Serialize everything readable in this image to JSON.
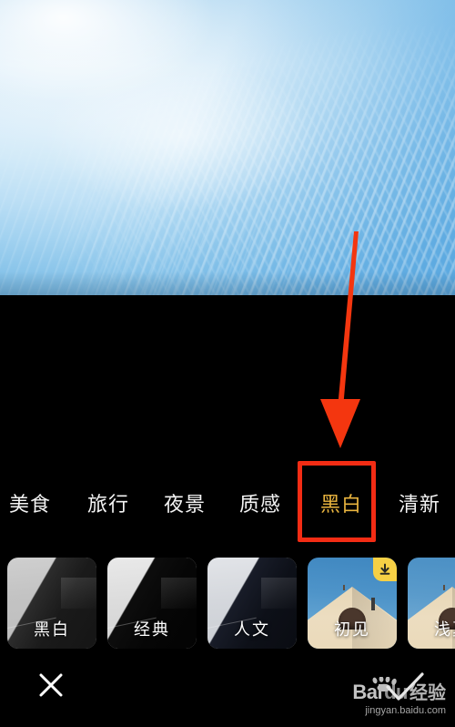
{
  "app": {
    "screen_name": "photo-filter-editor",
    "background_color": "#000000"
  },
  "preview": {
    "name": "sky-photo-preview",
    "description": "蓝天白云 cirrocumulus sky photo",
    "sky_blue": "#6ab2e4",
    "cloud_white": "#f2f9fd"
  },
  "annotation": {
    "arrow_color": "#f4360f",
    "highlight_color": "#f32c14",
    "points_to": "黑白"
  },
  "tabs": {
    "items": [
      {
        "label": "美食",
        "selected": false
      },
      {
        "label": "旅行",
        "selected": false
      },
      {
        "label": "夜景",
        "selected": false
      },
      {
        "label": "质感",
        "selected": false
      },
      {
        "label": "黑白",
        "selected": true
      },
      {
        "label": "清新",
        "selected": false
      }
    ],
    "selected_color": "#e9b43f",
    "normal_color": "#f4f4f4"
  },
  "filters": {
    "items": [
      {
        "label": "黑白",
        "style": "grayscale-1",
        "badge": null
      },
      {
        "label": "经典",
        "style": "grayscale-2",
        "badge": null
      },
      {
        "label": "人文",
        "style": "grayscale-3",
        "badge": null
      },
      {
        "label": "初见",
        "style": "color-1",
        "badge": "download-icon"
      },
      {
        "label": "浅夏",
        "style": "color-2",
        "badge": null
      }
    ],
    "badge_color": "#f6d045"
  },
  "bottom_bar": {
    "close_icon": "close-x-icon"
  },
  "watermark": {
    "brand_first": "Bai",
    "brand_second": "du",
    "brand_cn": "经验",
    "url": "jingyan.baidu.com"
  }
}
